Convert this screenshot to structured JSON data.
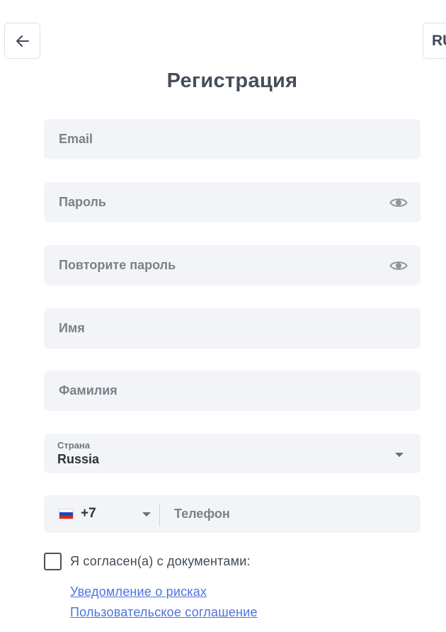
{
  "header": {
    "language": "RU",
    "title": "Регистрация"
  },
  "form": {
    "email_placeholder": "Email",
    "password_placeholder": "Пароль",
    "password_repeat_placeholder": "Повторите пароль",
    "first_name_placeholder": "Имя",
    "last_name_placeholder": "Фамилия",
    "country": {
      "label": "Страна",
      "value": "Russia"
    },
    "phone": {
      "flag_icon": "russia-flag-icon",
      "code": "+7",
      "placeholder": "Телефон"
    },
    "agreement": {
      "text": "Я согласен(а) с документами:",
      "checked": false,
      "links": [
        "Уведомление о рисках",
        "Пользовательское соглашение"
      ]
    }
  },
  "colors": {
    "field_bg": "#f3f4f8",
    "link": "#4f72df",
    "text": "#3f4a55",
    "placeholder": "#7b8188"
  }
}
